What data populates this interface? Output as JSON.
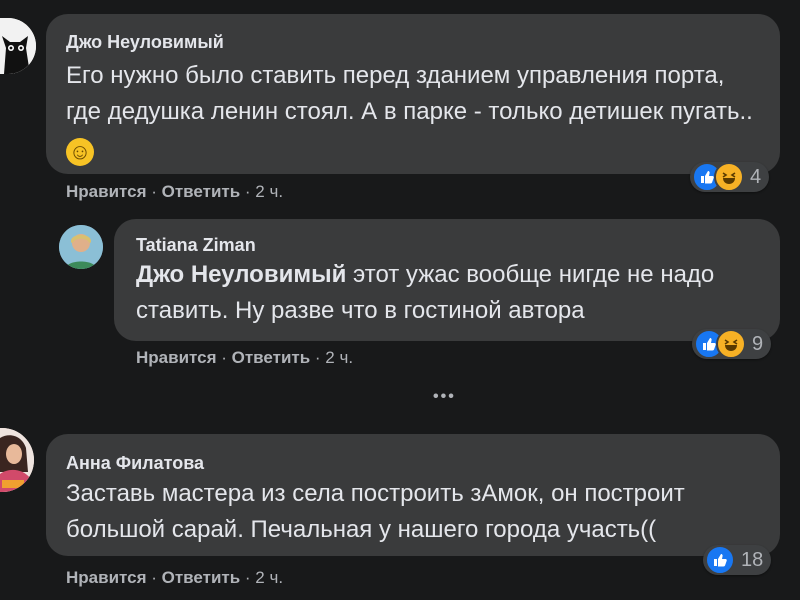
{
  "comments": [
    {
      "author": "Джо Неуловимый",
      "text": "Его нужно было ставить перед зданием управления порта, где дедушка ленин стоял. А в парке - только детишек пугать.. ",
      "emoji": "☺",
      "like_label": "Нравится",
      "reply_label": "Ответить",
      "time": "2 ч.",
      "reaction_count": "4",
      "reactions": [
        "like-icon",
        "haha-icon"
      ]
    },
    {
      "author": "Tatiana Ziman",
      "mention": "Джо Неуловимый",
      "text": " этот ужас вообще нигде не надо ставить. Ну разве что в гостиной автора",
      "like_label": "Нравится",
      "reply_label": "Ответить",
      "time": "2 ч.",
      "reaction_count": "9",
      "reactions": [
        "like-icon",
        "haha-icon"
      ]
    },
    {
      "author": "Анна Филатова",
      "text": "Заставь мастера из села построить зАмок, он построит большой сарай. Печальная у нашего города участь((",
      "like_label": "Нравится",
      "reply_label": "Ответить",
      "time": "2 ч.",
      "reaction_count": "18",
      "reactions": [
        "like-icon"
      ]
    }
  ],
  "separator": " · ",
  "more_label": "•••",
  "colors": {
    "background": "#18191a",
    "bubble": "#3a3b3c",
    "text": "#e4e6eb",
    "secondary": "#b0b3b8",
    "like": "#1877f2",
    "haha": "#f7b125"
  }
}
